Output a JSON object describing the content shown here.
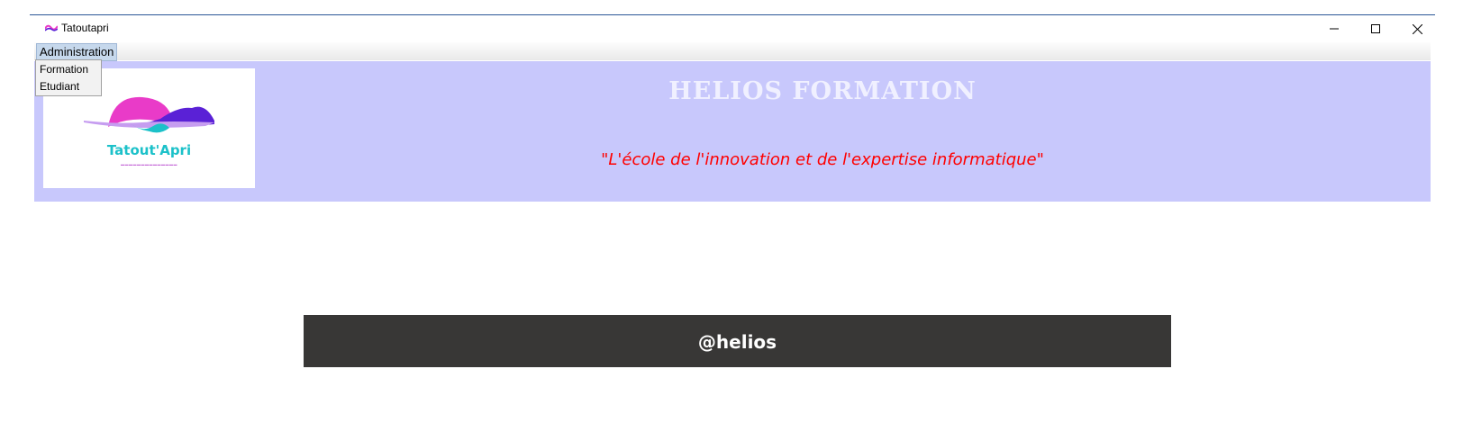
{
  "window": {
    "title": "Tatoutapri",
    "minimize_icon": "minimize-icon",
    "maximize_icon": "maximize-icon",
    "close_icon": "close-icon"
  },
  "menu": {
    "administration_label": "Administration",
    "dropdown_items": [
      "Formation",
      "Etudiant"
    ]
  },
  "header": {
    "logo_text": "Tatout'Apri",
    "brand_title": "HELIOS FORMATION",
    "slogan": "\"L'école de l'innovation et de l'expertise informatique\""
  },
  "footer": {
    "text": "@helios"
  },
  "colors": {
    "header_bg": "#c8c8fc",
    "slogan": "#ff0000",
    "footer_bg": "#383736",
    "logo_teal": "#1cc1c9",
    "logo_pink": "#e93bc8",
    "logo_purple": "#5a21d6"
  }
}
